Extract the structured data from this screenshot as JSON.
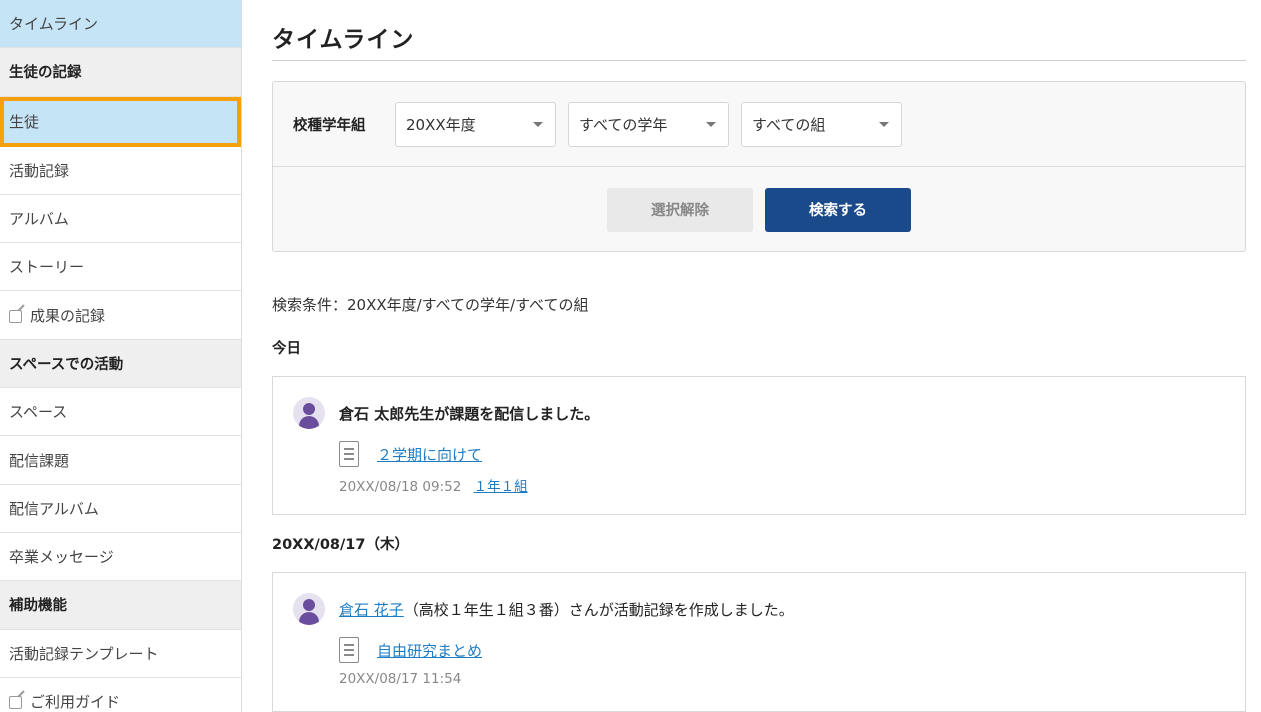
{
  "sidebar": {
    "items": [
      {
        "label": "タイムライン",
        "type": "active"
      },
      {
        "label": "生徒の記録",
        "type": "section"
      },
      {
        "label": "生徒",
        "type": "highlight"
      },
      {
        "label": "活動記録",
        "type": "item"
      },
      {
        "label": "アルバム",
        "type": "item"
      },
      {
        "label": "ストーリー",
        "type": "item"
      },
      {
        "label": "成果の記録",
        "type": "external"
      },
      {
        "label": "スペースでの活動",
        "type": "section"
      },
      {
        "label": "スペース",
        "type": "item"
      },
      {
        "label": "配信課題",
        "type": "item"
      },
      {
        "label": "配信アルバム",
        "type": "item"
      },
      {
        "label": "卒業メッセージ",
        "type": "item"
      },
      {
        "label": "補助機能",
        "type": "section"
      },
      {
        "label": "活動記録テンプレート",
        "type": "item"
      },
      {
        "label": "ご利用ガイド",
        "type": "external"
      }
    ]
  },
  "main": {
    "title": "タイムライン",
    "search": {
      "label": "校種学年組",
      "year": "20XX年度",
      "grade": "すべての学年",
      "class": "すべての組",
      "clear_label": "選択解除",
      "search_label": "検索する"
    },
    "condition": "検索条件：20XX年度/すべての学年/すべての組",
    "groups": [
      {
        "day": "今日",
        "entry": {
          "actor": "倉石 太郎先生が課題を配信しました。",
          "doc": "２学期に向けて",
          "time": "20XX/08/18 09:52",
          "class_link": "１年１組"
        }
      },
      {
        "day": "20XX/08/17（木）",
        "entry": {
          "actor_link": "倉石 花子",
          "actor_rest": "（高校１年生１組３番）さんが活動記録を作成しました。",
          "doc": "自由研究まとめ",
          "time": "20XX/08/17 11:54"
        }
      }
    ]
  }
}
